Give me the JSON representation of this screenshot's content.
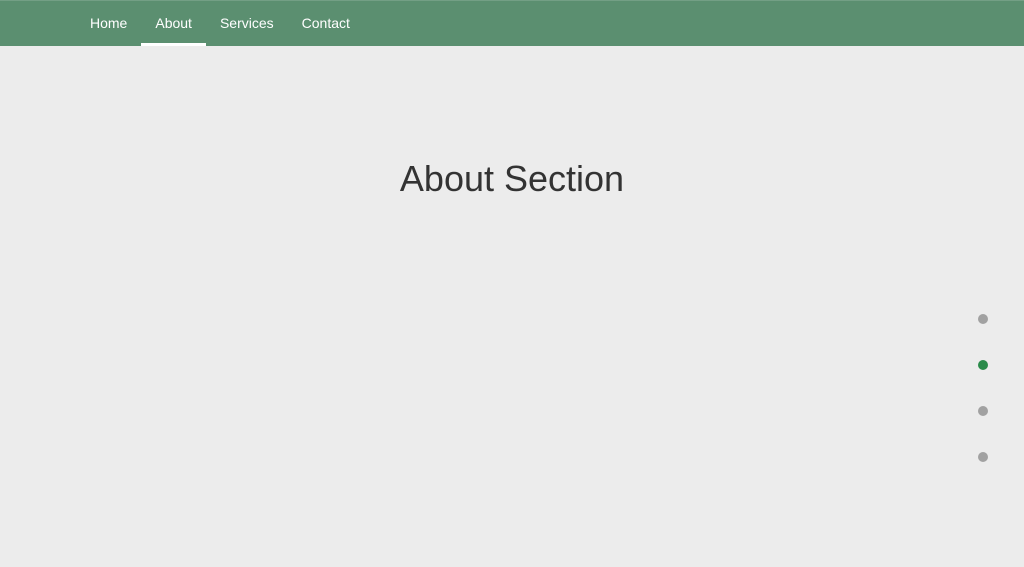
{
  "nav": {
    "items": [
      {
        "label": "Home",
        "active": false
      },
      {
        "label": "About",
        "active": true
      },
      {
        "label": "Services",
        "active": false
      },
      {
        "label": "Contact",
        "active": false
      }
    ]
  },
  "section": {
    "title": "About Section"
  },
  "dots": {
    "active_index": 1,
    "count": 4
  }
}
